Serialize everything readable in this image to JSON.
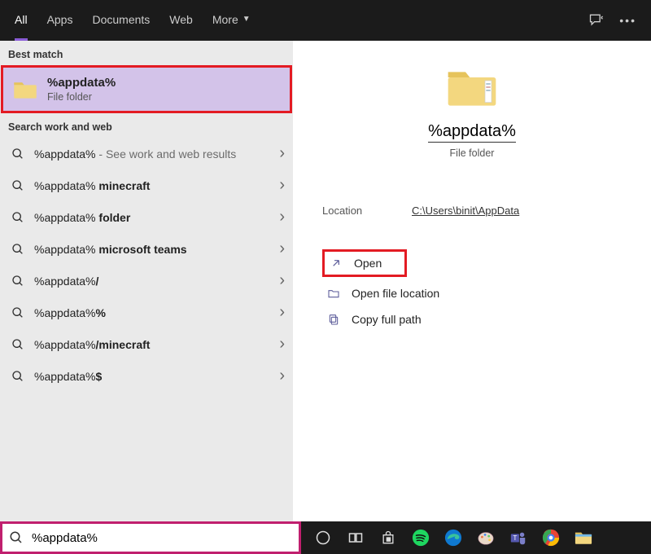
{
  "topbar": {
    "tabs": {
      "all": "All",
      "apps": "Apps",
      "documents": "Documents",
      "web": "Web",
      "more": "More"
    }
  },
  "left": {
    "best_match_label": "Best match",
    "best_match": {
      "title": "%appdata%",
      "sub": "File folder"
    },
    "search_label": "Search work and web",
    "results": [
      {
        "prefix": "%appdata%",
        "suffix": "See work and web results",
        "sep": " - "
      },
      {
        "prefix": "%appdata% ",
        "bold": "minecraft"
      },
      {
        "prefix": "%appdata% ",
        "bold": "folder"
      },
      {
        "prefix": "%appdata% ",
        "bold": "microsoft teams"
      },
      {
        "prefix": "%appdata%",
        "bold": "/"
      },
      {
        "prefix": "%appdata%",
        "bold": "%"
      },
      {
        "prefix": "%appdata%",
        "bold": "/minecraft"
      },
      {
        "prefix": "%appdata%",
        "bold": "$"
      }
    ]
  },
  "right": {
    "title": "%appdata%",
    "sub": "File folder",
    "location_label": "Location",
    "location_value": "C:\\Users\\binit\\AppData",
    "actions": {
      "open": "Open",
      "open_location": "Open file location",
      "copy_path": "Copy full path"
    }
  },
  "taskbar": {
    "search_value": "%appdata%"
  }
}
